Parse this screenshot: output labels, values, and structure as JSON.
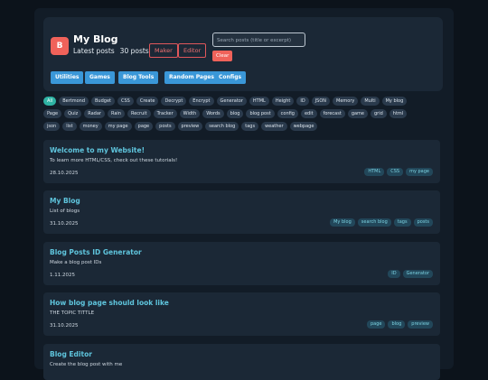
{
  "header": {
    "logo_letter": "B",
    "title": "My Blog",
    "latest_label": "Latest posts",
    "post_count": "30 posts",
    "maker_label": "Maker",
    "editor_label": "Editor",
    "search_placeholder": "Search posts (title or excerpt)",
    "clear_label": "Clear"
  },
  "nav": [
    "Utilities",
    "Games",
    "Blog Tools",
    "Random Pages",
    "Configs"
  ],
  "tags_row1": [
    "All",
    "Bertmond",
    "Budget",
    "CSS",
    "Create",
    "Decrypt",
    "Encrypt",
    "Generator",
    "HTML",
    "Height",
    "ID",
    "JSON",
    "Memory",
    "Multi",
    "My blog"
  ],
  "tags_row2": [
    "Page",
    "Quiz",
    "Radar",
    "Rain",
    "Recruit",
    "Tracker",
    "Width",
    "Words",
    "blog",
    "blog post",
    "config",
    "edit",
    "forecast",
    "game",
    "grid",
    "html"
  ],
  "tags_row3": [
    "json",
    "list",
    "money",
    "my page",
    "page",
    "posts",
    "preview",
    "search blog",
    "tags",
    "weather",
    "webpage"
  ],
  "posts": [
    {
      "title": "Welcome to my Website!",
      "desc": "To learn more HTML/CSS, check out these tutorials!",
      "date": "28.10.2025",
      "tags": [
        "HTML",
        "CSS",
        "my page"
      ]
    },
    {
      "title": "My Blog",
      "desc": "List of blogs",
      "date": "31.10.2025",
      "tags": [
        "My blog",
        "search blog",
        "tags",
        "posts"
      ]
    },
    {
      "title": "Blog Posts ID Generator",
      "desc": "Make a blog post IDs",
      "date": "1.11.2025",
      "tags": [
        "ID",
        "Generator"
      ]
    },
    {
      "title": "How blog page should look like",
      "desc": "THE TOPIC TITTLE",
      "date": "31.10.2025",
      "tags": [
        "page",
        "blog",
        "preview"
      ]
    },
    {
      "title": "Blog Editor",
      "desc": "Create the blog post with me",
      "date": "",
      "tags": []
    }
  ]
}
